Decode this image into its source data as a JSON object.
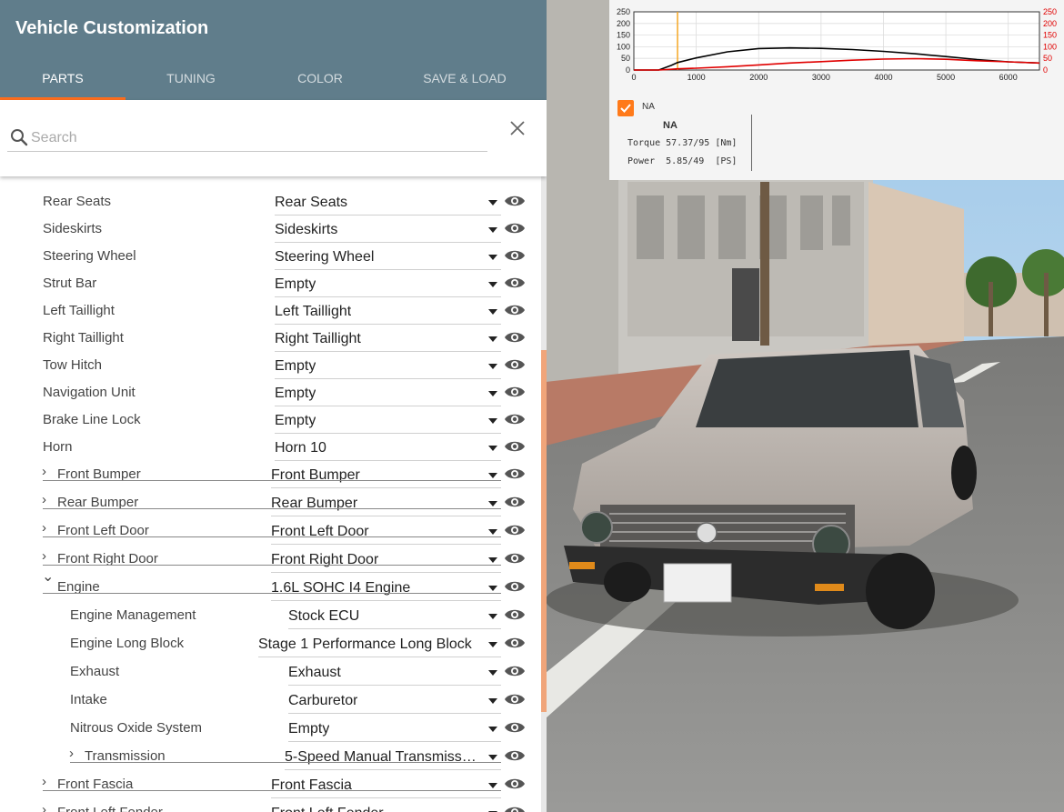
{
  "panel": {
    "title": "Vehicle Customization",
    "tabs": [
      "PARTS",
      "TUNING",
      "COLOR",
      "SAVE & LOAD"
    ],
    "active_tab": "PARTS",
    "search_placeholder": "Search"
  },
  "parts": [
    {
      "label": "Rear Seats",
      "value": "Rear Seats",
      "indent": 0,
      "expandable": false
    },
    {
      "label": "Sideskirts",
      "value": "Sideskirts",
      "indent": 0,
      "expandable": false
    },
    {
      "label": "Steering Wheel",
      "value": "Steering Wheel",
      "indent": 0,
      "expandable": false
    },
    {
      "label": "Strut Bar",
      "value": "Empty",
      "indent": 0,
      "expandable": false
    },
    {
      "label": "Left Taillight",
      "value": "Left Taillight",
      "indent": 0,
      "expandable": false
    },
    {
      "label": "Right Taillight",
      "value": "Right Taillight",
      "indent": 0,
      "expandable": false
    },
    {
      "label": "Tow Hitch",
      "value": "Empty",
      "indent": 0,
      "expandable": false
    },
    {
      "label": "Navigation Unit",
      "value": "Empty",
      "indent": 0,
      "expandable": false
    },
    {
      "label": "Brake Line Lock",
      "value": "Empty",
      "indent": 0,
      "expandable": false
    },
    {
      "label": "Horn",
      "value": "Horn 10",
      "indent": 0,
      "expandable": false
    },
    {
      "label": "Front Bumper",
      "value": "Front Bumper",
      "indent": 0,
      "expandable": true,
      "expanded": false
    },
    {
      "label": "Rear Bumper",
      "value": "Rear Bumper",
      "indent": 0,
      "expandable": true,
      "expanded": false
    },
    {
      "label": "Front Left Door",
      "value": "Front Left Door",
      "indent": 0,
      "expandable": true,
      "expanded": false
    },
    {
      "label": "Front Right Door",
      "value": "Front Right Door",
      "indent": 0,
      "expandable": true,
      "expanded": false
    },
    {
      "label": "Engine",
      "value": "1.6L SOHC I4 Engine",
      "indent": 0,
      "expandable": true,
      "expanded": true
    },
    {
      "label": "Engine Management",
      "value": "Stock ECU",
      "indent": 1,
      "expandable": false
    },
    {
      "label": "Engine Long Block",
      "value": "Stage 1 Performance Long Block",
      "indent": 1,
      "expandable": false
    },
    {
      "label": "Exhaust",
      "value": "Exhaust",
      "indent": 1,
      "expandable": false
    },
    {
      "label": "Intake",
      "value": "Carburetor",
      "indent": 1,
      "expandable": false
    },
    {
      "label": "Nitrous Oxide System",
      "value": "Empty",
      "indent": 1,
      "expandable": false
    },
    {
      "label": "Transmission",
      "value": "5-Speed Manual Transmiss…",
      "indent": 1,
      "expandable": true,
      "expanded": false
    },
    {
      "label": "Front Fascia",
      "value": "Front Fascia",
      "indent": 0,
      "expandable": true,
      "expanded": false
    },
    {
      "label": "Front Left Fender",
      "value": "Front Left Fender",
      "indent": 0,
      "expandable": true,
      "expanded": false
    }
  ],
  "chart_data": {
    "type": "line",
    "x_ticks": [
      "0",
      "1000",
      "2000",
      "3000",
      "4000",
      "5000",
      "6000"
    ],
    "y_left_ticks": [
      "250",
      "200",
      "150",
      "100",
      "50",
      "0"
    ],
    "y_right_ticks": [
      "250",
      "200",
      "150",
      "100",
      "50",
      "0"
    ],
    "xlim": [
      0,
      6500
    ],
    "ylim": [
      0,
      250
    ],
    "cursor_x": 700,
    "series": [
      {
        "color": "#000000",
        "x": [
          0,
          400,
          600,
          700,
          1000,
          1500,
          2000,
          2500,
          3000,
          3500,
          4000,
          4500,
          5000,
          5500,
          6000,
          6500
        ],
        "y": [
          0,
          0,
          20,
          32,
          52,
          78,
          92,
          95,
          93,
          88,
          80,
          70,
          58,
          45,
          35,
          30
        ]
      },
      {
        "color": "#e00000",
        "x": [
          0,
          400,
          600,
          700,
          1000,
          1500,
          2000,
          2500,
          3000,
          3500,
          4000,
          4500,
          5000,
          5500,
          6000,
          6500
        ],
        "y": [
          0,
          0,
          3,
          5,
          8,
          14,
          22,
          30,
          36,
          42,
          47,
          49,
          46,
          40,
          35,
          30
        ]
      }
    ],
    "legend": {
      "label": "NA",
      "checked": true
    }
  },
  "info": {
    "title": "NA",
    "torque": "Torque 57.37/95 [Nm]",
    "power": "Power  5.85/49  [PS]"
  },
  "colors": {
    "header": "#607d8b",
    "accent": "#ff6e1c",
    "torque_line": "#000000",
    "power_line": "#e00000",
    "cursor": "#f5a623"
  }
}
